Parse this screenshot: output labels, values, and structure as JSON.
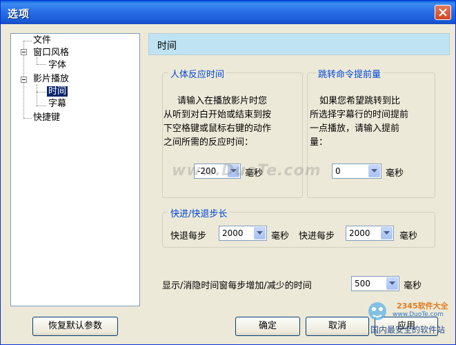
{
  "window": {
    "title": "选项"
  },
  "tree": {
    "items": [
      {
        "label": "文件"
      },
      {
        "label": "窗口风格"
      },
      {
        "label": "字体"
      },
      {
        "label": "影片播放"
      },
      {
        "label": "时间"
      },
      {
        "label": "字幕"
      },
      {
        "label": "快捷键"
      }
    ],
    "selected": "时间"
  },
  "panel": {
    "header": "时间"
  },
  "reaction": {
    "legend": "人体反应时间",
    "text": [
      "请输入在播放影片时您",
      "从听到对白开始或结束到按",
      "下空格键或鼠标右键的动作",
      "之间所需的反应时间："
    ],
    "value": "-200",
    "unit": "毫秒"
  },
  "jump": {
    "legend": "跳转命令提前量",
    "text": [
      "如果您希望跳转到比",
      "所选择字幕行的时间提前",
      "一点播放，请输入提前",
      "量："
    ],
    "value": "0",
    "unit": "毫秒"
  },
  "step": {
    "legend": "快进/快退步长",
    "back_label": "快退每步",
    "back_value": "2000",
    "back_unit": "毫秒",
    "fwd_label": "快进每步",
    "fwd_value": "2000",
    "fwd_unit": "毫秒"
  },
  "display": {
    "label": "显示/消隐时间窗每步增加/减少的时间",
    "value": "500",
    "unit": "毫秒"
  },
  "buttons": {
    "reset": "恢复默认参数",
    "ok": "确定",
    "cancel": "取消",
    "apply": "应用"
  },
  "watermarks": {
    "center": "www.DuoTe.com",
    "brand": "2345软件大全",
    "site": "www.DuoTe.com",
    "caption": "国内最安全的软件站"
  },
  "colors": {
    "title_bar": "#2a6fe6",
    "legend_text": "#0046d5",
    "header_bg": "#bfe3f3"
  }
}
